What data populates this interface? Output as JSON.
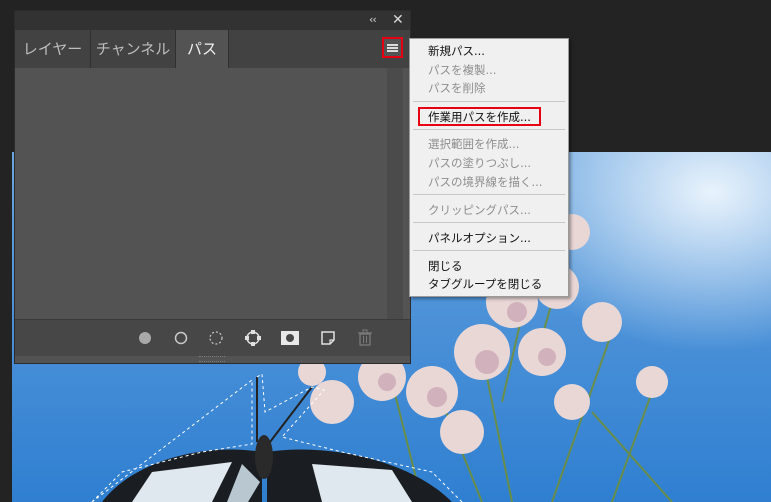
{
  "panel": {
    "collapse_label": "‹‹",
    "close_label": "✕",
    "tabs": [
      {
        "label": "レイヤー",
        "active": false
      },
      {
        "label": "チャンネル",
        "active": false
      },
      {
        "label": "パス",
        "active": true
      }
    ],
    "footer_icons": [
      "fill-path-icon",
      "stroke-path-icon",
      "load-selection-icon",
      "make-work-path-icon",
      "add-mask-icon",
      "new-path-icon",
      "trash-icon"
    ]
  },
  "flyout_menu": {
    "items": [
      {
        "label": "新規パス...",
        "enabled": true
      },
      {
        "label": "パスを複製...",
        "enabled": false
      },
      {
        "label": "パスを削除",
        "enabled": false
      },
      {
        "label": "作業用パスを作成...",
        "enabled": true,
        "highlighted": true
      },
      {
        "label": "選択範囲を作成...",
        "enabled": false
      },
      {
        "label": "パスの塗りつぶし...",
        "enabled": false
      },
      {
        "label": "パスの境界線を描く...",
        "enabled": false
      },
      {
        "label": "クリッピングパス...",
        "enabled": false
      },
      {
        "label": "パネルオプション...",
        "enabled": true
      },
      {
        "label": "閉じる",
        "enabled": true
      },
      {
        "label": "タブグループを閉じる",
        "enabled": true
      }
    ]
  },
  "colors": {
    "highlight_red": "#e60012",
    "panel_bg": "#535353",
    "menu_bg": "#f0f0f0"
  }
}
